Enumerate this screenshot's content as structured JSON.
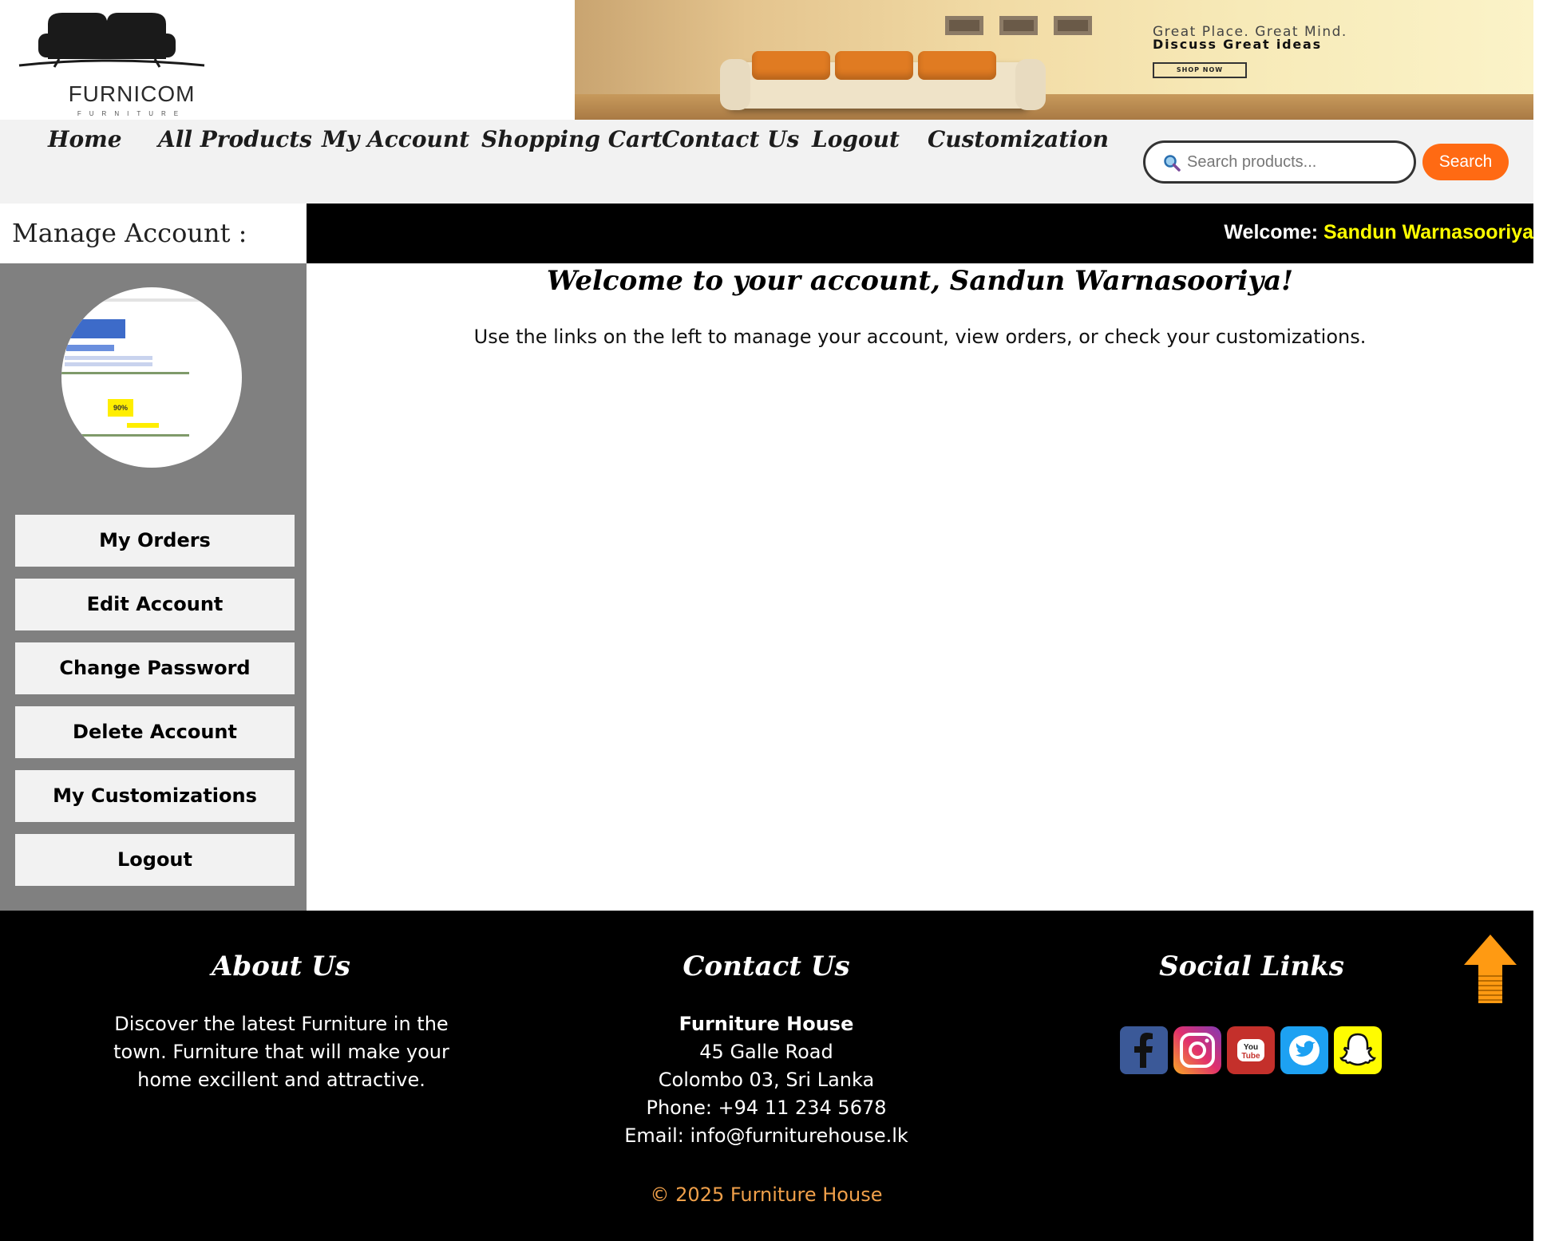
{
  "brand": {
    "logo_name": "FURNICOM",
    "logo_sub": "FURNITURE"
  },
  "banner": {
    "line1": "Great Place. Great Mind.",
    "line2": "Discuss Great ideas",
    "button": "SHOP NOW"
  },
  "nav": {
    "items": [
      "Home",
      "All Products",
      "My Account",
      "Shopping Cart",
      "Contact Us",
      "Logout",
      "Customization"
    ]
  },
  "search": {
    "placeholder": "Search products...",
    "button": "Search"
  },
  "account": {
    "manage_label": "Manage Account :",
    "welcome_prefix": "Welcome:",
    "user_name": "Sandun Warnasooriya",
    "avatar_badge": "90%"
  },
  "sidebar": {
    "buttons": [
      "My Orders",
      "Edit Account",
      "Change Password",
      "Delete Account",
      "My Customizations",
      "Logout"
    ]
  },
  "main": {
    "title": "Welcome to your account, Sandun Warnasooriya!",
    "description": "Use the links on the left to manage your account, view orders, or check your customizations."
  },
  "footer": {
    "about": {
      "heading": "About Us",
      "text": "Discover the latest Furniture in the town. Furniture that will make your home excillent and attractive."
    },
    "contact": {
      "heading": "Contact Us",
      "name": "Furniture House",
      "address1": "45 Galle Road",
      "address2": "Colombo 03, Sri Lanka",
      "phone": "Phone: +94 11 234 5678",
      "email": "Email: info@furniturehouse.lk"
    },
    "social": {
      "heading": "Social Links",
      "icons": [
        "facebook-icon",
        "instagram-icon",
        "youtube-icon",
        "twitter-icon",
        "snapchat-icon"
      ]
    },
    "copyright": "© 2025 Furniture House"
  },
  "colors": {
    "accent_orange": "#ff6a13",
    "welcome_yellow": "#ffff00",
    "sidebar_gray": "#808080",
    "copyright_orange": "#f0a04a"
  }
}
